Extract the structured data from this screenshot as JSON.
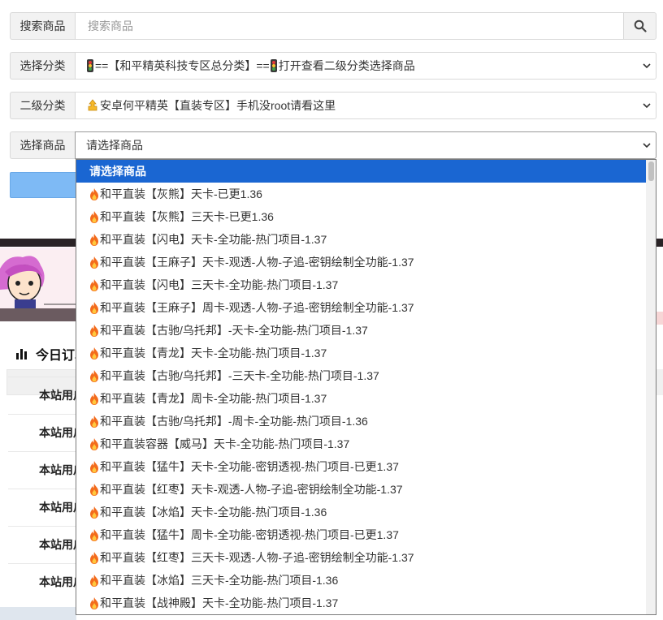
{
  "form": {
    "search": {
      "label": "搜索商品",
      "placeholder": "搜索商品"
    },
    "category": {
      "label": "选择分类",
      "value": "==【和平精英科技专区总分类】==",
      "value_suffix": "打开查看二级分类选择商品"
    },
    "subcategory": {
      "label": "二级分类",
      "value": "安卓何平精英【直装专区】手机没root请看这里"
    },
    "product": {
      "label": "选择商品",
      "value": "请选择商品"
    }
  },
  "background": {
    "section_title": "今日订单",
    "order_rows": [
      "本站用户",
      "本站用户",
      "本站用户",
      "本站用户",
      "本站用户",
      "本站用户"
    ]
  },
  "dropdown": {
    "selected_option": "请选择商品",
    "options": [
      "和平直装【灰熊】天卡-已更1.36",
      "和平直装【灰熊】三天卡-已更1.36",
      "和平直装【闪电】天卡-全功能-热门项目-1.37",
      "和平直装【王麻子】天卡-观透-人物-子追-密钥绘制全功能-1.37",
      "和平直装【闪电】三天卡-全功能-热门项目-1.37",
      "和平直装【王麻子】周卡-观透-人物-子追-密钥绘制全功能-1.37",
      "和平直装【古驰/乌托邦】-天卡-全功能-热门项目-1.37",
      "和平直装【青龙】天卡-全功能-热门项目-1.37",
      "和平直装【古驰/乌托邦】-三天卡-全功能-热门项目-1.37",
      "和平直装【青龙】周卡-全功能-热门项目-1.37",
      "和平直装【古驰/乌托邦】-周卡-全功能-热门项目-1.36",
      "和平直装容器【威马】天卡-全功能-热门项目-1.37",
      "和平直装【猛牛】天卡-全功能-密钥透视-热门项目-已更1.37",
      "和平直装【红枣】天卡-观透-人物-子追-密钥绘制全功能-1.37",
      "和平直装【冰焰】天卡-全功能-热门项目-1.36",
      "和平直装【猛牛】周卡-全功能-密钥透视-热门项目-已更1.37",
      "和平直装【红枣】三天卡-观透-人物-子追-密钥绘制全功能-1.37",
      "和平直装【冰焰】三天卡-全功能-热门项目-1.36",
      "和平直装【战神殿】天卡-全功能-热门项目-1.37"
    ]
  },
  "colors": {
    "selected_bg": "#1a66d2",
    "submit_bg": "#7ebaf5",
    "fire": "#f36b1c"
  }
}
